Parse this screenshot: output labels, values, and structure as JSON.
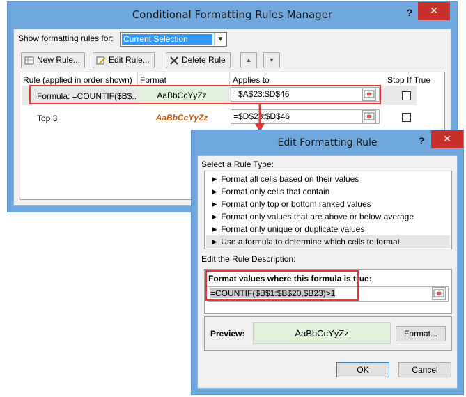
{
  "dialog1": {
    "title": "Conditional Formatting Rules Manager",
    "help": "?",
    "close": "✕",
    "show_label": "Show formatting rules for:",
    "show_value": "Current Selection",
    "toolbar": {
      "new_rule": "New Rule...",
      "edit_rule": "Edit Rule...",
      "delete_rule": "Delete Rule"
    },
    "columns": {
      "rule": "Rule (applied in order shown)",
      "format": "Format",
      "applies_to": "Applies to",
      "stop_if_true": "Stop If True"
    },
    "rules": [
      {
        "rule": "Formula: =COUNTIF($B$...",
        "format_sample": "AaBbCcYyZz",
        "applies_to": "=$A$23:$D$46"
      },
      {
        "rule": "Top 3",
        "format_sample": "AaBbCcYyZz",
        "applies_to": "=$D$23:$D$46"
      }
    ]
  },
  "dialog2": {
    "title": "Edit Formatting Rule",
    "help": "?",
    "close": "✕",
    "select_type_label": "Select a Rule Type:",
    "rule_types": [
      "► Format all cells based on their values",
      "► Format only cells that contain",
      "► Format only top or bottom ranked values",
      "► Format only values that are above or below average",
      "► Format only unique or duplicate values",
      "► Use a formula to determine which cells to format"
    ],
    "edit_desc_label": "Edit the Rule Description:",
    "formula_label": "Format values where this formula is true:",
    "formula": "=COUNTIF($B$1:$B$20,$B23)>1",
    "preview_label": "Preview:",
    "preview_sample": "AaBbCcYyZz",
    "format_button": "Format...",
    "ok": "OK",
    "cancel": "Cancel"
  },
  "colors": {
    "title_bar": "#6fa8dc",
    "close_red": "#c9302c",
    "highlight_red": "#e53935",
    "preview_green": "#e2efda",
    "top3_orange": "#c55a11"
  }
}
